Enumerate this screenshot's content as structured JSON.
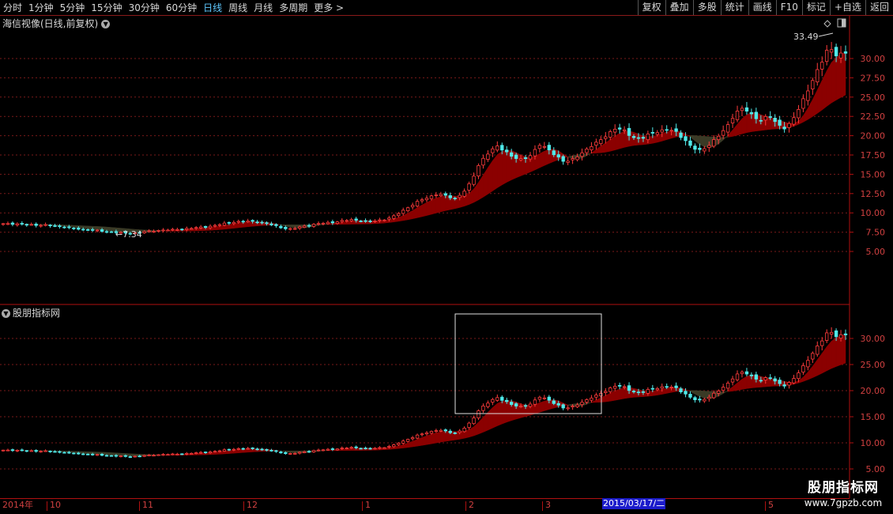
{
  "toolbar": {
    "periods": [
      "分时",
      "1分钟",
      "5分钟",
      "15分钟",
      "30分钟",
      "60分钟",
      "日线",
      "周线",
      "月线",
      "多周期",
      "更多 >"
    ],
    "active_period": "日线",
    "buttons": [
      "复权",
      "叠加",
      "多股",
      "统计",
      "画线",
      "F10",
      "标记",
      "+自选",
      "返回"
    ]
  },
  "main_panel": {
    "title": "海信视像(日线,前复权)",
    "high_label": "33.49",
    "low_label": "←7.34",
    "y_ticks": [
      "30.00",
      "27.50",
      "25.00",
      "22.50",
      "20.00",
      "17.50",
      "15.00",
      "12.50",
      "10.00",
      "7.50",
      "5.00"
    ]
  },
  "indicator_panel": {
    "title": "股朋指标网",
    "y_ticks": [
      "30.00",
      "25.00",
      "20.00",
      "15.00",
      "10.00",
      "5.00"
    ]
  },
  "date_axis": {
    "labels": [
      "2014年",
      "10",
      "11",
      "12",
      "1",
      "2",
      "3",
      "5"
    ],
    "cursor_date": "2015/03/17/二"
  },
  "watermark": {
    "line1": "股朋指标网",
    "line2": "www.7gpzb.com"
  },
  "colors": {
    "up": "#ff3b3b",
    "down": "#4fe8e8",
    "ribbon_bull": "#8b0000",
    "ribbon_bear": "#3a3a26",
    "axis": "#b01010",
    "grid": "#7a1a1a"
  },
  "chart_data": {
    "type": "candlestick",
    "ylim_main": [
      5,
      33.49
    ],
    "ylim_indicator": [
      5,
      33.49
    ],
    "close_series": [
      8.6,
      8.6,
      8.5,
      8.5,
      8.4,
      8.4,
      8.3,
      8.2,
      8.0,
      7.9,
      7.8,
      7.7,
      7.6,
      7.5,
      7.4,
      7.34,
      7.5,
      7.6,
      7.7,
      7.8,
      7.8,
      7.9,
      8.0,
      8.1,
      8.2,
      8.4,
      8.6,
      8.8,
      8.9,
      8.9,
      8.8,
      8.6,
      8.3,
      8.0,
      7.9,
      8.2,
      8.4,
      8.6,
      8.7,
      8.8,
      9.0,
      9.1,
      9.0,
      8.9,
      9.0,
      9.2,
      9.6,
      10.3,
      11.0,
      11.6,
      12.0,
      12.5,
      12.2,
      11.8,
      12.6,
      14.0,
      16.5,
      17.8,
      18.6,
      18.0,
      17.2,
      16.8,
      17.5,
      18.9,
      18.2,
      17.4,
      16.6,
      16.9,
      17.8,
      18.6,
      19.2,
      20.2,
      21.0,
      20.6,
      19.8,
      19.6,
      20.2,
      20.6,
      20.8,
      20.5,
      19.6,
      18.4,
      18.0,
      18.9,
      19.9,
      21.0,
      23.0,
      23.6,
      22.6,
      22.0,
      22.6,
      21.4,
      21.0,
      22.4,
      24.6,
      27.0,
      29.0,
      31.5,
      30.5,
      30.6
    ]
  }
}
